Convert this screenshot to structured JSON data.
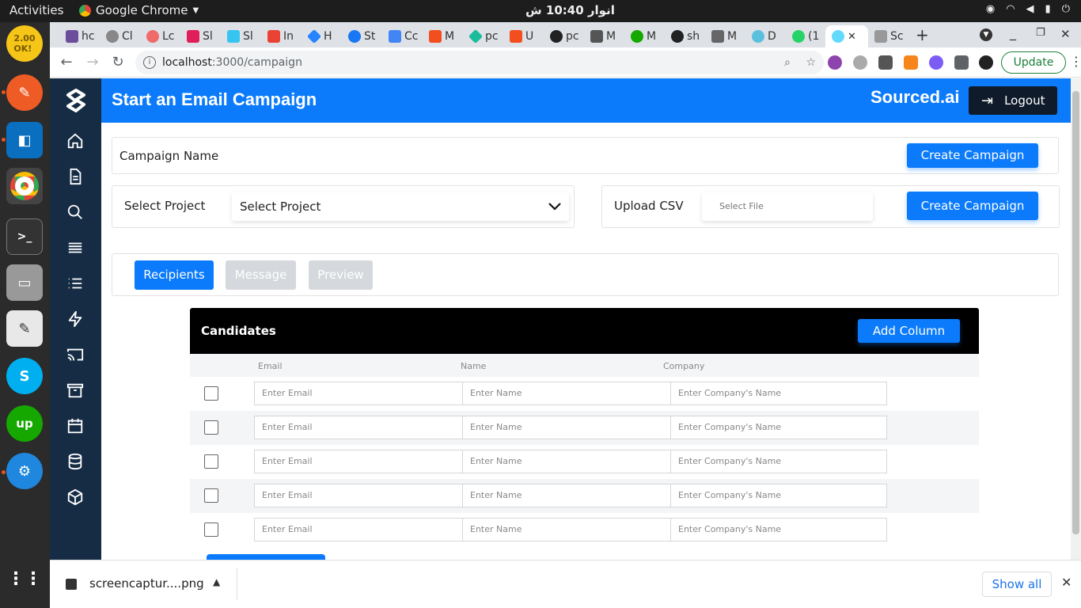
{
  "os": {
    "activities": "Activities",
    "app_name": "Google Chrome",
    "clock": "انوار 10:40 ش"
  },
  "browser": {
    "tabs": [
      "hc",
      "Cl",
      "Lc",
      "Sl",
      "Sl",
      "In",
      "H",
      "St",
      "Cc",
      "M",
      "pc",
      "U",
      "pc",
      "M",
      "M",
      "sh",
      "M",
      "D",
      "(1",
      "",
      "Sc"
    ],
    "url_host": "localhost",
    "url_path": ":3000/campaign",
    "update_label": "Update",
    "download_file": "screencaptur....png",
    "show_all": "Show all"
  },
  "header": {
    "title": "Start an Email Campaign",
    "brand": "Sourced.ai",
    "logout": "Logout"
  },
  "campaign_name": {
    "label": "Campaign Name",
    "button": "Create Campaign"
  },
  "project": {
    "label": "Select Project",
    "selected": "Select Project"
  },
  "csv": {
    "label": "Upload CSV",
    "file_placeholder": "Select File",
    "button": "Create Campaign"
  },
  "steps": {
    "recipients": "Recipients",
    "message": "Message",
    "preview": "Preview"
  },
  "candidates": {
    "title": "Candidates",
    "add_column": "Add Column",
    "columns": [
      "Email",
      "Name",
      "Company"
    ],
    "placeholders": {
      "email": "Enter Email",
      "name": "Enter Name",
      "company": "Enter Company's Name"
    }
  },
  "colors": {
    "primary": "#0b7bfb",
    "sidebar": "#152c44",
    "dock": "#2b2b2b"
  }
}
